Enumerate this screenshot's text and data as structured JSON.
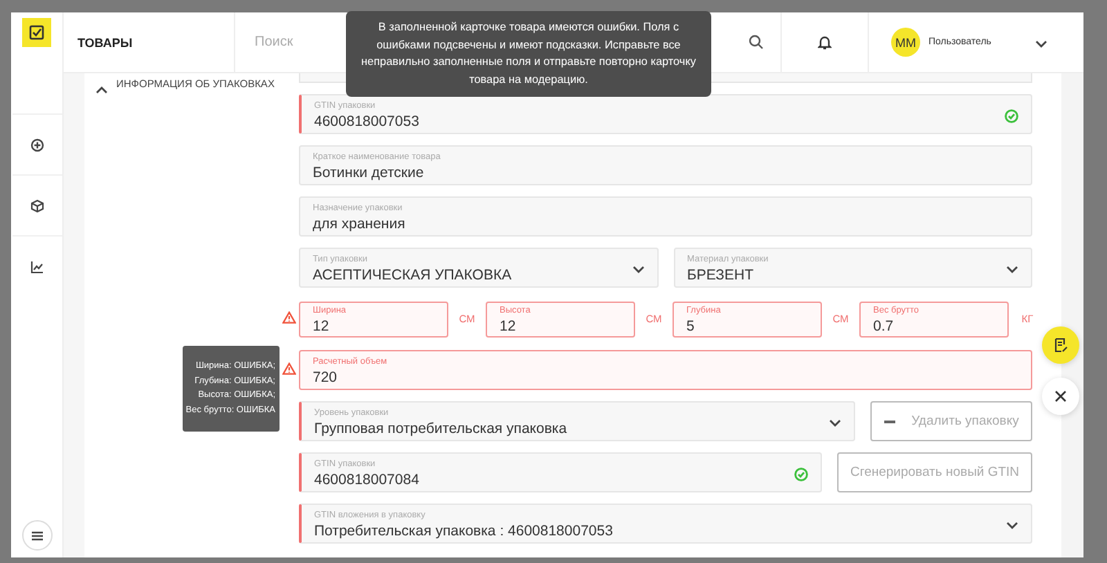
{
  "header": {
    "title": "ТОВАРЫ",
    "search": {
      "placeholder": "Поиск"
    },
    "user": {
      "initials": "MM",
      "name": "Пользователь"
    }
  },
  "notice": {
    "text": "В заполненной карточке товара имеются ошибки. Поля с ошибками подсвечены и имеют подсказки. Исправьте все неправильно заполненные поля и отправьте повторно карточку товара на модерацию."
  },
  "section": {
    "title": "ИНФОРМАЦИЯ ОБ УПАКОВКАХ",
    "expanded": true
  },
  "rows": [
    {
      "warning": false,
      "cells": [
        {
          "kind": "text",
          "label": "GTIN упаковки",
          "value": "4600818007053",
          "flagged": true,
          "error": false,
          "valid": true
        }
      ]
    },
    {
      "warning": false,
      "cells": [
        {
          "kind": "text",
          "label": "Краткое наименование товара",
          "value": "Ботинки детские",
          "flagged": false,
          "error": false,
          "valid": false
        }
      ]
    },
    {
      "warning": false,
      "cells": [
        {
          "kind": "text",
          "label": "Назначение упаковки",
          "value": "для хранения",
          "flagged": false,
          "error": false,
          "valid": false
        }
      ]
    },
    {
      "warning": false,
      "cells": [
        {
          "kind": "select",
          "label": "Тип упаковки",
          "value": "АСЕПТИЧЕСКАЯ УПАКОВКА",
          "flagged": false,
          "error": false
        },
        {
          "kind": "select",
          "label": "Материал упаковки",
          "value": "БРЕЗЕНТ",
          "flagged": false,
          "error": false
        }
      ]
    },
    {
      "warning": true,
      "cells": [
        {
          "kind": "measure",
          "label": "Ширина",
          "value": "12",
          "unit": "СМ",
          "error": true
        },
        {
          "kind": "measure",
          "label": "Высота",
          "value": "12",
          "unit": "СМ",
          "error": true
        },
        {
          "kind": "measure",
          "label": "Глубина",
          "value": "5",
          "unit": "СМ",
          "error": true
        },
        {
          "kind": "measure",
          "label": "Вес брутто",
          "value": "0.7",
          "unit": "КГ",
          "error": true
        }
      ]
    },
    {
      "warning": true,
      "cells": [
        {
          "kind": "text",
          "label": "Расчетный объем",
          "value": "720",
          "flagged": false,
          "error": true,
          "valid": false
        }
      ]
    },
    {
      "warning": false,
      "cells": [
        {
          "kind": "select",
          "label": "Уровень упаковки",
          "value": "Групповая потребительская упаковка",
          "flagged": true,
          "error": false
        },
        {
          "kind": "remove",
          "label": "Удалить упаковку"
        }
      ]
    },
    {
      "warning": false,
      "cells": [
        {
          "kind": "text",
          "label": "GTIN упаковки",
          "value": "4600818007084",
          "flagged": true,
          "error": false,
          "valid": true
        },
        {
          "kind": "generate",
          "label": "Сгенерировать новый GTIN"
        }
      ]
    },
    {
      "warning": false,
      "cells": [
        {
          "kind": "select",
          "label": "GTIN вложения в упаковку",
          "value": "Потребительская упаковка : 4600818007053",
          "flagged": true,
          "error": false
        }
      ]
    }
  ],
  "error_tooltip": {
    "lines": [
      "Ширина: ОШИБКА;",
      "Глубина: ОШИБКА;",
      "Высота: ОШИБКА;",
      "Вес брутто: ОШИБКА"
    ]
  }
}
